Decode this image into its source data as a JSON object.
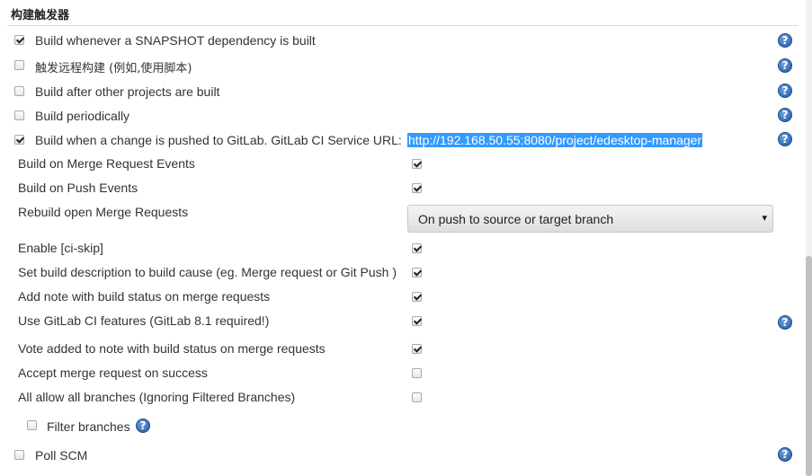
{
  "section": {
    "title": "构建触发器"
  },
  "triggers": [
    {
      "label": "Build whenever a SNAPSHOT dependency is built",
      "checked": true
    },
    {
      "label": "触发远程构建 (例如,使用脚本)",
      "checked": false
    },
    {
      "label": "Build after other projects are built",
      "checked": false
    },
    {
      "label": "Build periodically",
      "checked": false
    },
    {
      "label": "Build when a change is pushed to GitLab. GitLab CI Service URL:",
      "checked": true
    }
  ],
  "gitlab": {
    "service_url": "http://192.168.50.55:8080/project/edesktop-manager",
    "options": [
      {
        "label": "Build on Merge Request Events",
        "checked": true
      },
      {
        "label": "Build on Push Events",
        "checked": true
      },
      {
        "label": "Enable [ci-skip]",
        "checked": true
      },
      {
        "label": "Set build description to build cause (eg. Merge request or Git Push )",
        "checked": true
      },
      {
        "label": "Add note with build status on merge requests",
        "checked": true
      },
      {
        "label": "Use GitLab CI features (GitLab 8.1 required!)",
        "checked": true
      },
      {
        "label": "Vote added to note with build status on merge requests",
        "checked": true
      },
      {
        "label": "Accept merge request on success",
        "checked": false
      },
      {
        "label": "All allow all branches (Ignoring Filtered Branches)",
        "checked": false
      }
    ],
    "rebuild": {
      "label": "Rebuild open Merge Requests",
      "selected": "On push to source or target branch",
      "arrow": "▾"
    },
    "filter_branches": {
      "label": "Filter branches",
      "checked": false
    }
  },
  "poll_scm": {
    "label": "Poll SCM",
    "checked": false
  },
  "help_glyph": "?"
}
